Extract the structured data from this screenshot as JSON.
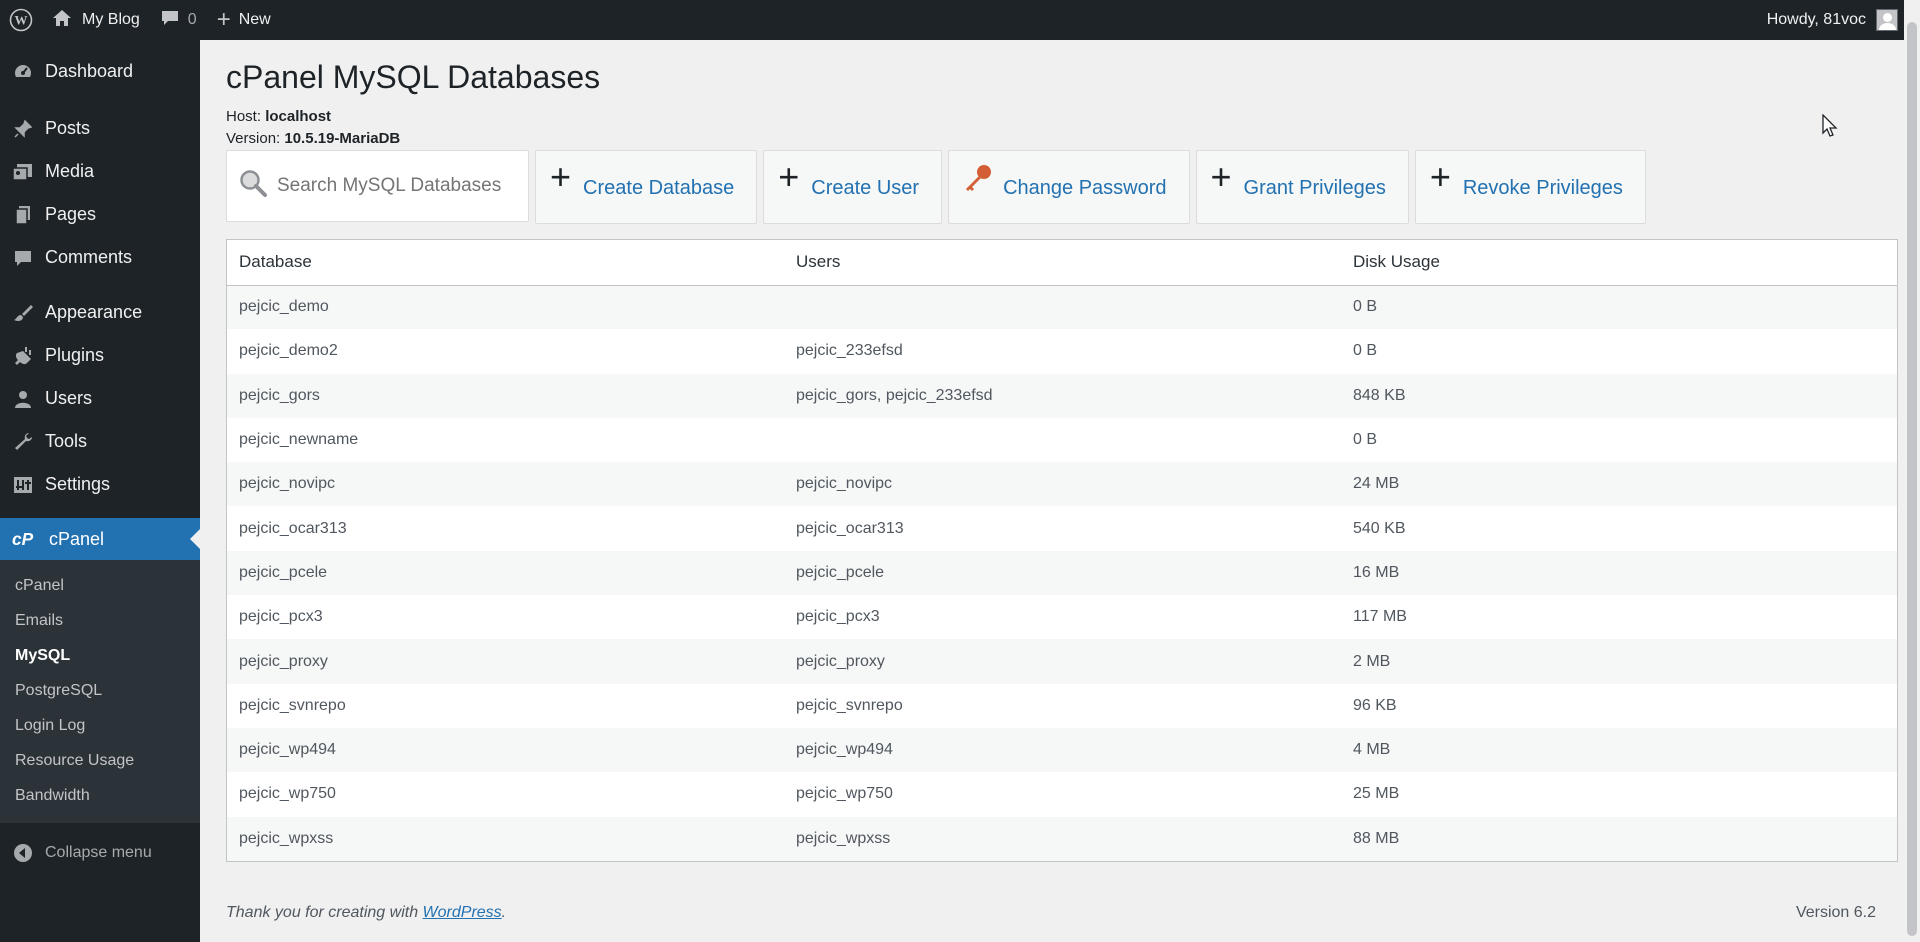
{
  "adminbar": {
    "site_name": "My Blog",
    "comment_count": "0",
    "new_label": "New",
    "howdy": "Howdy, 81voc"
  },
  "sidebar": {
    "items": [
      {
        "label": "Dashboard",
        "icon": "dashboard-icon"
      },
      {
        "label": "Posts",
        "icon": "pin-icon"
      },
      {
        "label": "Media",
        "icon": "media-icon"
      },
      {
        "label": "Pages",
        "icon": "pages-icon"
      },
      {
        "label": "Comments",
        "icon": "comment-icon"
      },
      {
        "label": "Appearance",
        "icon": "brush-icon"
      },
      {
        "label": "Plugins",
        "icon": "plug-icon"
      },
      {
        "label": "Users",
        "icon": "user-icon"
      },
      {
        "label": "Tools",
        "icon": "wrench-icon"
      },
      {
        "label": "Settings",
        "icon": "settings-icon"
      }
    ],
    "active": {
      "label": "cPanel",
      "icon": "cpanel-logo-icon"
    },
    "submenu": [
      "cPanel",
      "Emails",
      "MySQL",
      "PostgreSQL",
      "Login Log",
      "Resource Usage",
      "Bandwidth"
    ],
    "current_sub": "MySQL",
    "collapse": "Collapse menu"
  },
  "page": {
    "title": "cPanel MySQL Databases",
    "host_label": "Host:",
    "host": "localhost",
    "version_label": "Version:",
    "version": "10.5.19-MariaDB",
    "search_placeholder": "Search MySQL Databases...",
    "buttons": {
      "create_db": "Create Database",
      "create_user": "Create User",
      "change_password": "Change Password",
      "grant": "Grant Privileges",
      "revoke": "Revoke Privileges"
    }
  },
  "table": {
    "headers": [
      "Database",
      "Users",
      "Disk Usage"
    ],
    "rows": [
      [
        "pejcic_demo",
        "",
        "0 B"
      ],
      [
        "pejcic_demo2",
        "pejcic_233efsd",
        "0 B"
      ],
      [
        "pejcic_gors",
        "pejcic_gors, pejcic_233efsd",
        "848 KB"
      ],
      [
        "pejcic_newname",
        "",
        "0 B"
      ],
      [
        "pejcic_novipc",
        "pejcic_novipc",
        "24 MB"
      ],
      [
        "pejcic_ocar313",
        "pejcic_ocar313",
        "540 KB"
      ],
      [
        "pejcic_pcele",
        "pejcic_pcele",
        "16 MB"
      ],
      [
        "pejcic_pcx3",
        "pejcic_pcx3",
        "117 MB"
      ],
      [
        "pejcic_proxy",
        "pejcic_proxy",
        "2 MB"
      ],
      [
        "pejcic_svnrepo",
        "pejcic_svnrepo",
        "96 KB"
      ],
      [
        "pejcic_wp494",
        "pejcic_wp494",
        "4 MB"
      ],
      [
        "pejcic_wp750",
        "pejcic_wp750",
        "25 MB"
      ],
      [
        "pejcic_wpxss",
        "pejcic_wpxss",
        "88 MB"
      ]
    ]
  },
  "footer": {
    "thanks_prefix": "Thank you for creating with ",
    "link": "WordPress",
    "suffix": ".",
    "version": "Version 6.2"
  },
  "colors": {
    "accent": "#2271b1",
    "adminbar": "#1d2327",
    "key": "#d35f36"
  }
}
